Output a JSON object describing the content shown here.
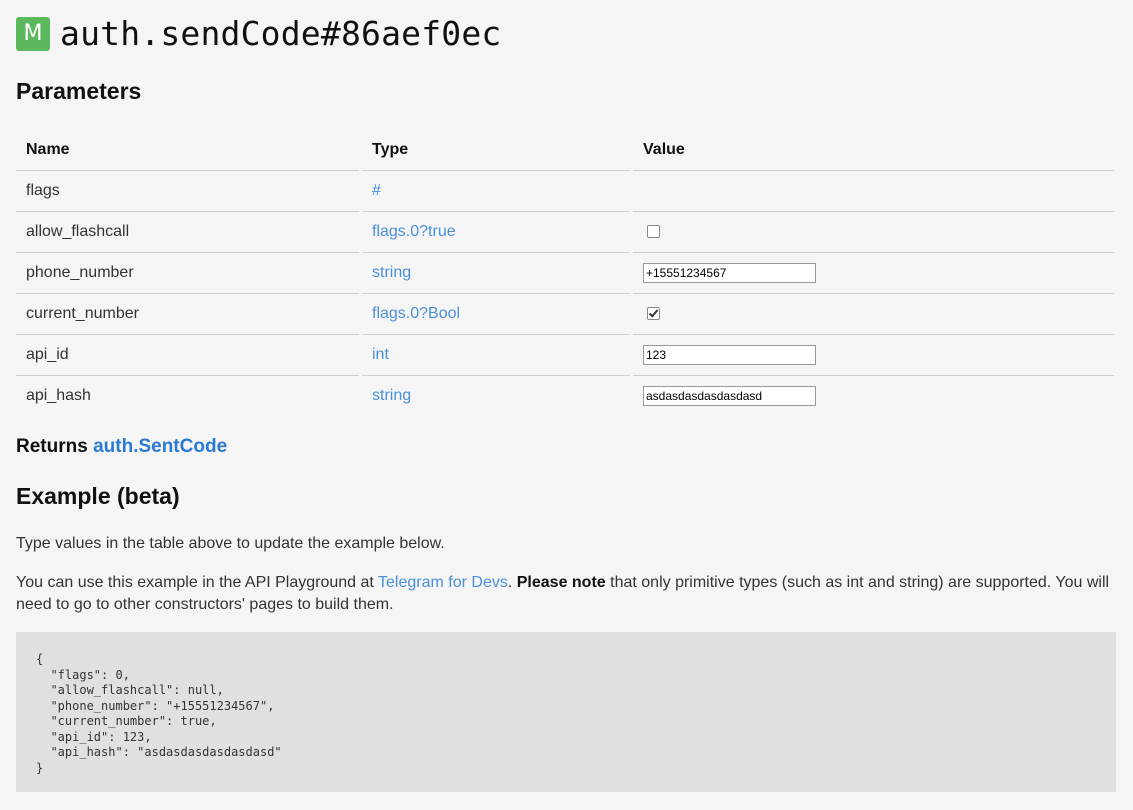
{
  "header": {
    "badge": "M",
    "title": "auth.sendCode#86aef0ec"
  },
  "parameters": {
    "heading": "Parameters",
    "columns": [
      "Name",
      "Type",
      "Value"
    ],
    "rows": [
      {
        "name": "flags",
        "type": "#",
        "value_kind": "none",
        "value": ""
      },
      {
        "name": "allow_flashcall",
        "type": "flags.0?true",
        "value_kind": "checkbox",
        "checked": false
      },
      {
        "name": "phone_number",
        "type": "string",
        "value_kind": "text",
        "value": "+15551234567"
      },
      {
        "name": "current_number",
        "type": "flags.0?Bool",
        "value_kind": "checkbox",
        "checked": true
      },
      {
        "name": "api_id",
        "type": "int",
        "value_kind": "text",
        "value": "123"
      },
      {
        "name": "api_hash",
        "type": "string",
        "value_kind": "text",
        "value": "asdasdasdasdasdasd"
      }
    ]
  },
  "returns": {
    "label": "Returns",
    "type": "auth.SentCode"
  },
  "example": {
    "heading": "Example (beta)",
    "intro": "Type values in the table above to update the example below.",
    "note_prefix": "You can use this example in the API Playground at ",
    "note_link": "Telegram for Devs",
    "note_mid": ". ",
    "note_bold": "Please note",
    "note_suffix": " that only primitive types (such as int and string) are supported. You will need to go to other constructors' pages to build them.",
    "code": "{\n  \"flags\": 0,\n  \"allow_flashcall\": null,\n  \"phone_number\": \"+15551234567\",\n  \"current_number\": true,\n  \"api_id\": 123,\n  \"api_hash\": \"asdasdasdasdasdasd\"\n}"
  },
  "colors": {
    "badge": "#5cb85c",
    "link": "#4a90d9",
    "background": "#f5f5f5",
    "code_background": "#e0e0e0"
  }
}
